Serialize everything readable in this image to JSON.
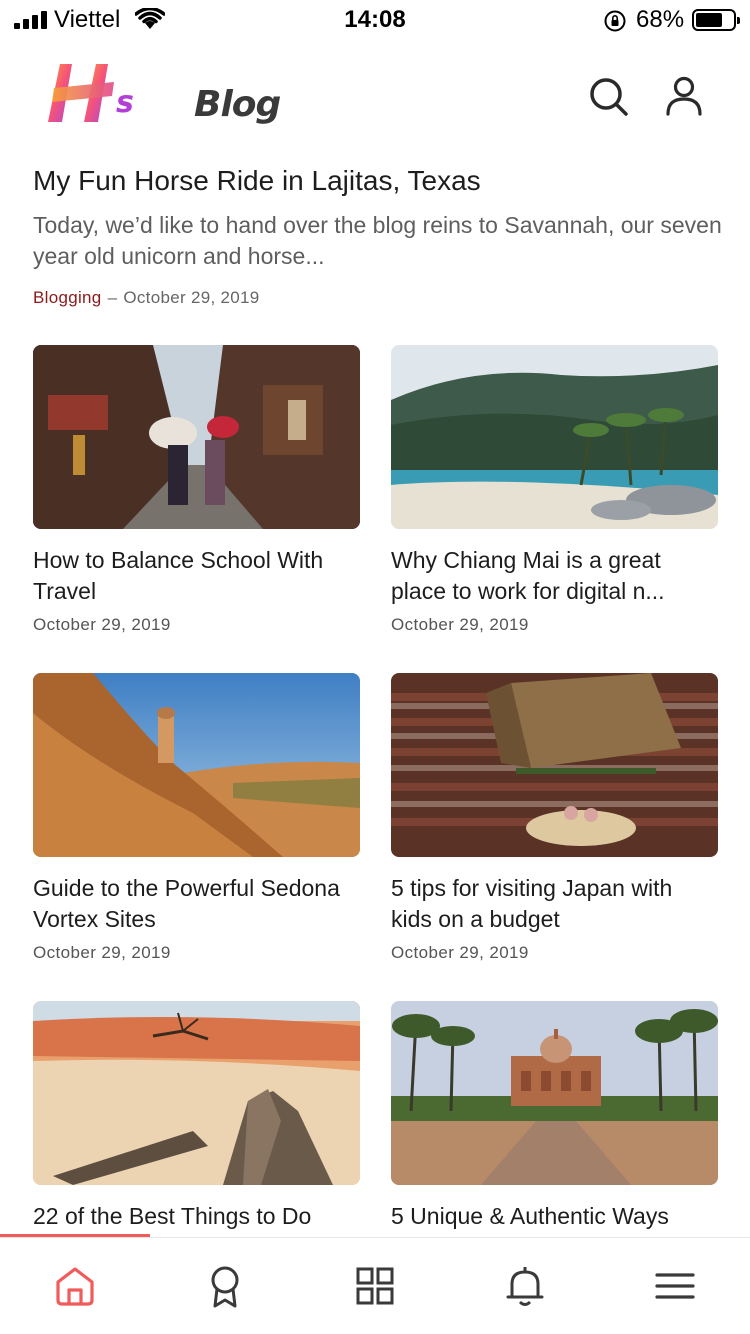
{
  "status_bar": {
    "carrier": "Viettel",
    "time": "14:08",
    "battery": "68%"
  },
  "header": {
    "logo_text": "Blog",
    "logo_mark": "HS",
    "icons": [
      "search-icon",
      "user-icon"
    ]
  },
  "featured": {
    "title": "My Fun Horse Ride in Lajitas, Texas",
    "excerpt": "Today, we’d like to hand over the blog reins to Savannah, our seven year old unicorn and horse...",
    "category": "Blogging",
    "separator": "–",
    "date": "October 29, 2019"
  },
  "posts": [
    {
      "title": "How to Balance School With Travel",
      "date": "October 29, 2019",
      "image": "kyoto-street-photo"
    },
    {
      "title": "Why Chiang Mai is a great place to work for digital n...",
      "date": "October 29, 2019",
      "image": "tropical-beach-photo"
    },
    {
      "title": "Guide to the Powerful Sedona Vortex Sites",
      "date": "October 29, 2019",
      "image": "canyon-hoodoo-photo"
    },
    {
      "title": "5 tips for visiting Japan with kids on a budget",
      "date": "October 29, 2019",
      "image": "sumo-arena-photo"
    },
    {
      "title": "22 of the Best Things to Do",
      "date": "",
      "image": "desert-dead-tree-photo"
    },
    {
      "title": "5 Unique & Authentic Ways",
      "date": "",
      "image": "palace-palms-photo"
    }
  ],
  "bottom_nav": {
    "active": "home",
    "accent_color": "#f15b5b",
    "items": [
      "home-icon",
      "award-icon",
      "grid-icon",
      "bell-icon",
      "menu-icon"
    ]
  }
}
